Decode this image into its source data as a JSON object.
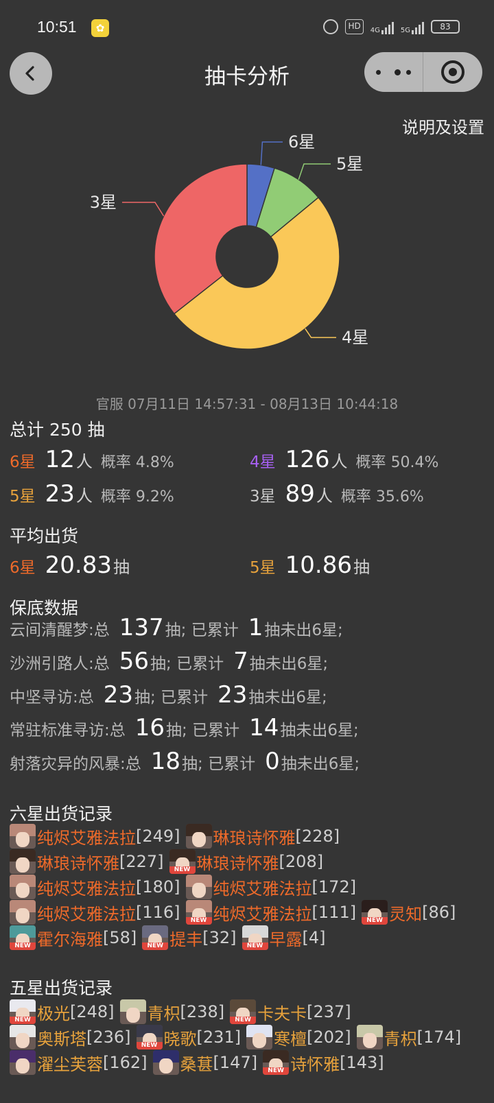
{
  "status_bar": {
    "time": "10:51",
    "battery": "83",
    "network_1": "4G",
    "network_2": "5G",
    "hd_badge": "HD",
    "icons": [
      "app-bunny-icon",
      "alarm-icon",
      "hd-icon",
      "signal-4g-icon",
      "signal-5g-icon",
      "battery-icon"
    ]
  },
  "nav": {
    "title": "抽卡分析",
    "back_icon": "chevron-left-icon",
    "more_icon": "more-dots-icon",
    "target_icon": "target-icon"
  },
  "settings_link": "说明及设置",
  "chart_data": {
    "type": "pie",
    "donut": true,
    "slices": [
      {
        "label": "6星",
        "value": 12,
        "color": "#5470c6"
      },
      {
        "label": "5星",
        "value": 23,
        "color": "#91cc75"
      },
      {
        "label": "4星",
        "value": 126,
        "color": "#fac858"
      },
      {
        "label": "3星",
        "value": 89,
        "color": "#ee6666"
      }
    ]
  },
  "date_range": "官服  07月11日 14:57:31  -  08月13日 10:44:18",
  "summary": {
    "title": "总计 250 抽",
    "person_unit": "人",
    "prob_label": "概率",
    "rows": [
      {
        "star": "6星",
        "count": "12",
        "prob": "4.8%"
      },
      {
        "star": "4星",
        "count": "126",
        "prob": "50.4%"
      },
      {
        "star": "5星",
        "count": "23",
        "prob": "9.2%"
      },
      {
        "star": "3星",
        "count": "89",
        "prob": "35.6%"
      }
    ]
  },
  "average": {
    "title": "平均出货",
    "unit": "抽",
    "six": {
      "star": "6星",
      "value": "20.83"
    },
    "five": {
      "star": "5星",
      "value": "10.86"
    }
  },
  "pity": {
    "title": "保底数据",
    "mid_text": "抽;  已累计",
    "end_text": "抽未出6星;",
    "rows": [
      {
        "pool": "云间清醒梦:总",
        "total": "137",
        "accum": "1"
      },
      {
        "pool": "沙洲引路人:总",
        "total": "56",
        "accum": "7"
      },
      {
        "pool": "中坚寻访:总",
        "total": "23",
        "accum": "23"
      },
      {
        "pool": "常驻标准寻访:总",
        "total": "16",
        "accum": "14"
      },
      {
        "pool": "射落灾异的风暴:总",
        "total": "18",
        "accum": "0"
      }
    ]
  },
  "six_star_records": {
    "title": "六星出货记录",
    "lines": [
      [
        {
          "name": "纯烬艾雅法拉",
          "count": "[249]",
          "new": false,
          "hair": "#b98878"
        },
        {
          "name": "琳琅诗怀雅",
          "count": "[228]",
          "new": false,
          "hair": "#3a2a22"
        }
      ],
      [
        {
          "name": "琳琅诗怀雅",
          "count": "[227]",
          "new": false,
          "hair": "#3a2a22"
        },
        {
          "name": "琳琅诗怀雅",
          "count": "[208]",
          "new": true,
          "hair": "#3a2a22"
        }
      ],
      [
        {
          "name": "纯烬艾雅法拉",
          "count": "[180]",
          "new": false,
          "hair": "#b98878"
        },
        {
          "name": "纯烬艾雅法拉",
          "count": "[172]",
          "new": false,
          "hair": "#b98878"
        }
      ],
      [
        {
          "name": "纯烬艾雅法拉",
          "count": "[116]",
          "new": false,
          "hair": "#b98878"
        },
        {
          "name": "纯烬艾雅法拉",
          "count": "[111]",
          "new": true,
          "hair": "#b98878"
        },
        {
          "name": "灵知",
          "count": "[86]",
          "new": true,
          "hair": "#2a1e1c"
        }
      ],
      [
        {
          "name": "霍尔海雅",
          "count": "[58]",
          "new": true,
          "hair": "#4e9a9a"
        },
        {
          "name": "提丰",
          "count": "[32]",
          "new": true,
          "hair": "#6a6a80"
        },
        {
          "name": "早露",
          "count": "[4]",
          "new": true,
          "hair": "#d8d8d8"
        }
      ]
    ]
  },
  "five_star_records": {
    "title": "五星出货记录",
    "lines": [
      [
        {
          "name": "极光",
          "count": "[248]",
          "new": true,
          "hair": "#e9e9ef"
        },
        {
          "name": "青枳",
          "count": "[238]",
          "new": false,
          "hair": "#c8c8a8"
        },
        {
          "name": "卡夫卡",
          "count": "[237]",
          "new": true,
          "hair": "#5b4a3a"
        }
      ],
      [
        {
          "name": "奥斯塔",
          "count": "[236]",
          "new": false,
          "hair": "#e6e6e6"
        },
        {
          "name": "晓歌",
          "count": "[231]",
          "new": true,
          "hair": "#3a3a4a"
        },
        {
          "name": "寒檀",
          "count": "[202]",
          "new": false,
          "hair": "#dfe3f2"
        },
        {
          "name": "青枳",
          "count": "[174]",
          "new": false,
          "hair": "#c8c8a8"
        }
      ],
      [
        {
          "name": "濯尘芙蓉",
          "count": "[162]",
          "new": false,
          "hair": "#4a2e6a"
        },
        {
          "name": "桑葚",
          "count": "[147]",
          "new": false,
          "hair": "#2e2e6a"
        },
        {
          "name": "诗怀雅",
          "count": "[143]",
          "new": true,
          "hair": "#3a2a22"
        }
      ]
    ]
  }
}
